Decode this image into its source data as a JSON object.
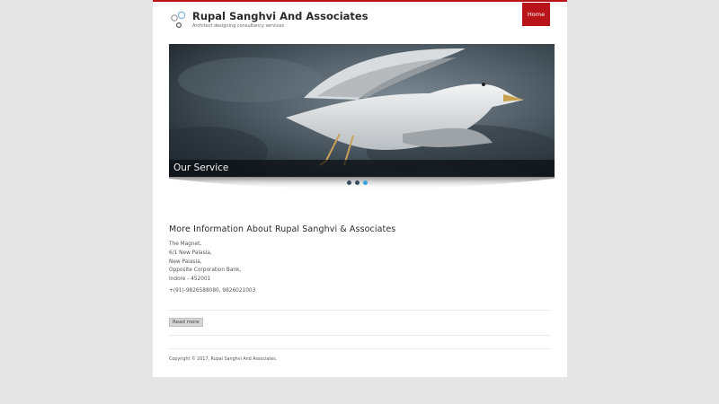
{
  "site": {
    "title": "Rupal Sanghvi And Associates",
    "tagline": "Architect designing consultancy services",
    "accent_color": "#b8141a"
  },
  "nav": {
    "home_label": "Home"
  },
  "slider": {
    "caption": "Our Service",
    "slide_count": 3,
    "active_slide": 3,
    "image_subject": "seagull in flight against stormy sky"
  },
  "info": {
    "heading": "More Information About Rupal Sanghvi & Associates",
    "address_lines": [
      "The Magnet,",
      "6/1 New Palasia,",
      "New Palasia,",
      "Opposite Corporation Bank,",
      "Indore - 452001"
    ],
    "phone": "+(91)-9826588080, 9826021003",
    "read_more_label": "Read more"
  },
  "footer": {
    "copyright": "Copyright © 2017, Rupal Sanghvi And Associates."
  }
}
